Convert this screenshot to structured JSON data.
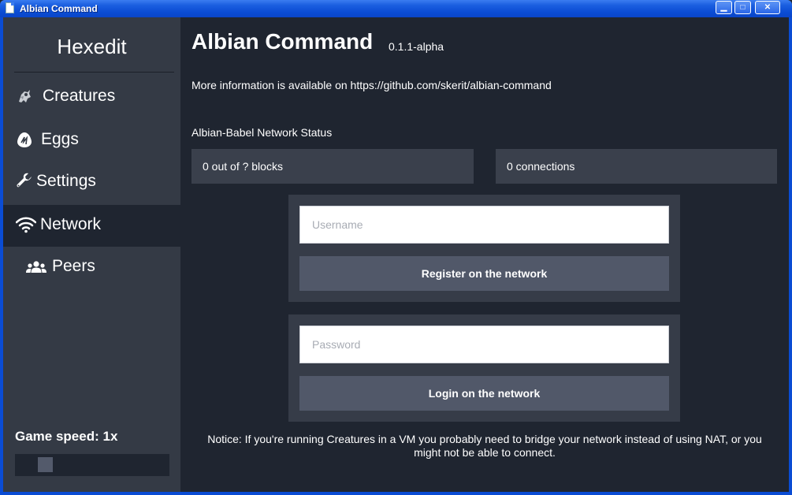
{
  "window": {
    "title": "Albian Command",
    "controls": {
      "minimize": "▁",
      "maximize": "□",
      "close": "✕"
    }
  },
  "sidebar": {
    "brand": "Hexedit",
    "items": [
      {
        "label": "Creatures",
        "icon": "creature-icon",
        "active": false
      },
      {
        "label": "Eggs",
        "icon": "egg-icon",
        "active": false
      },
      {
        "label": "Settings",
        "icon": "wrench-icon",
        "active": false
      },
      {
        "label": "Network",
        "icon": "wifi-icon",
        "active": true
      },
      {
        "label": "Peers",
        "icon": "users-icon",
        "active": false,
        "sub": true
      }
    ],
    "game_speed_label": "Game speed: 1x",
    "game_speed_value": 1
  },
  "main": {
    "title": "Albian Command",
    "version": "0.1.1-alpha",
    "info": "More information is available on https://github.com/skerit/albian-command",
    "status_heading": "Albian-Babel Network Status",
    "blocks_status": "0 out of ? blocks",
    "connections_status": "0 connections",
    "register": {
      "username_placeholder": "Username",
      "username_value": "",
      "button": "Register on the network"
    },
    "login": {
      "password_placeholder": "Password",
      "password_value": "",
      "button": "Login on the network"
    },
    "notice": "Notice: If you're running Creatures in a VM you probably need to bridge your network instead of using NAT, or you might not be able to connect."
  },
  "colors": {
    "background": "#1f2530",
    "sidebar": "#343a45",
    "panel": "#3a404c",
    "button": "#515869",
    "titlebar": "#0a4cd4"
  }
}
